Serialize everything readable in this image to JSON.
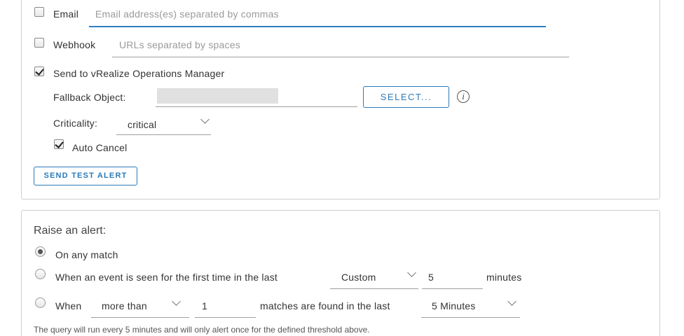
{
  "notifications": {
    "email": {
      "label": "Email",
      "checked": false,
      "placeholder": "Email address(es) separated by commas",
      "value": ""
    },
    "webhook": {
      "label": "Webhook",
      "checked": false,
      "placeholder": "URLs separated by spaces",
      "value": ""
    },
    "vrops": {
      "label": "Send to vRealize Operations Manager",
      "checked": true,
      "fallback_label": "Fallback Object:",
      "select_button": "SELECT...",
      "info_icon": "i",
      "criticality_label": "Criticality:",
      "criticality_value": "critical",
      "auto_cancel_label": "Auto Cancel",
      "auto_cancel_checked": true
    },
    "send_test_alert": "SEND TEST ALERT"
  },
  "raise_alert": {
    "title": "Raise an alert:",
    "options": {
      "any_match": {
        "label": "On any match",
        "selected": true
      },
      "first_time": {
        "label": "When an event is seen for the first time in the last",
        "period_value": "Custom",
        "amount_value": "5",
        "unit_label": "minutes",
        "selected": false
      },
      "threshold": {
        "label_when": "When",
        "comparator_value": "more than",
        "count_value": "1",
        "middle_label": "matches are found in the last",
        "window_value": "5 Minutes",
        "selected": false
      }
    },
    "note": "The query will run every 5 minutes and will only alert once for the defined threshold above."
  }
}
